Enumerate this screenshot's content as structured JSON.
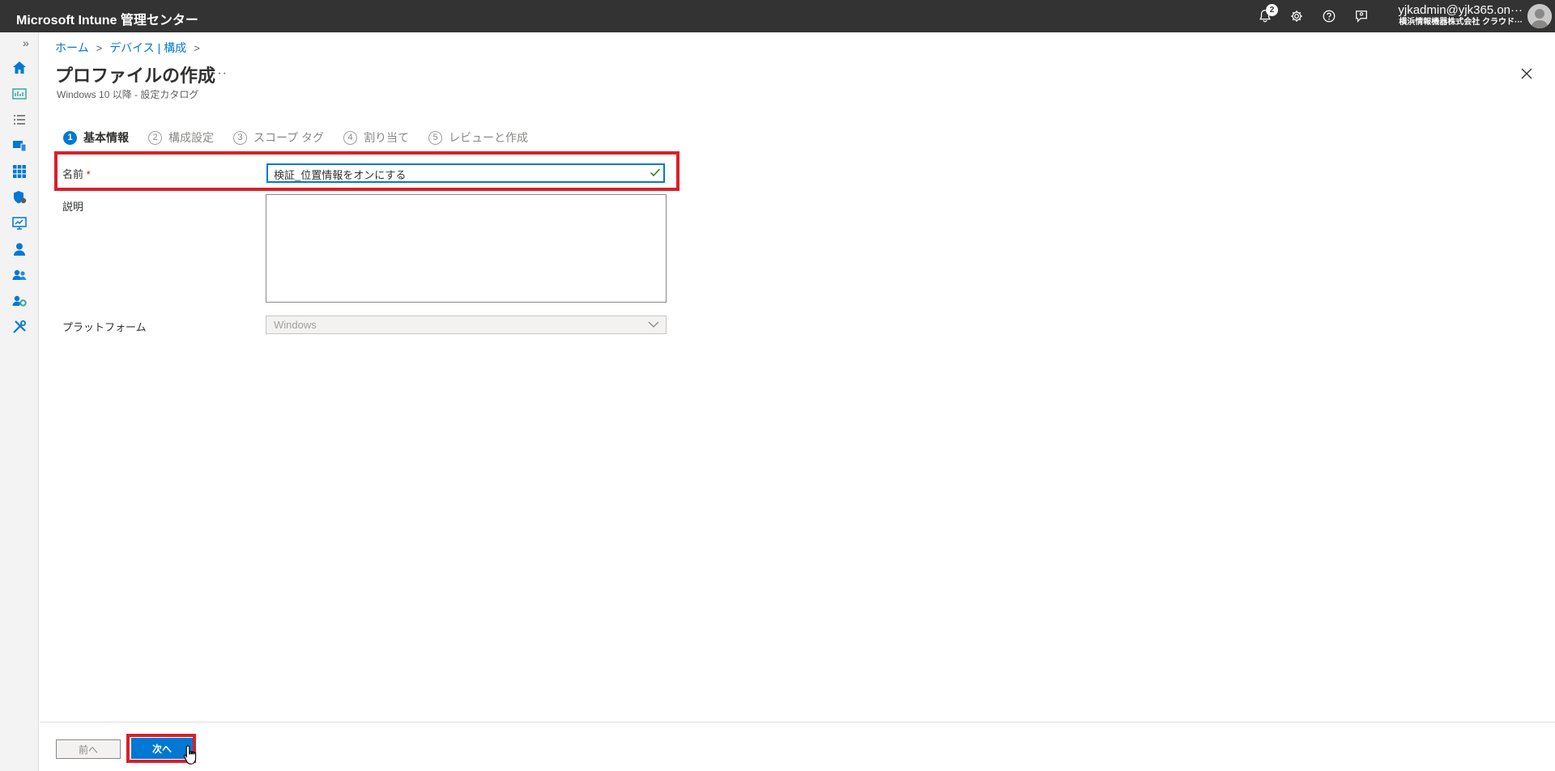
{
  "topbar": {
    "title": "Microsoft Intune 管理センター",
    "notification_count": "2",
    "icons": [
      "bell-icon",
      "gear-icon",
      "help-icon",
      "feedback-icon"
    ],
    "account_email": "yjkadmin@yjk365.on···",
    "account_org": "横浜情報機器株式会社 クラウド···"
  },
  "rail": {
    "expand_label": "»",
    "items": [
      "home-icon",
      "dashboard-icon",
      "all-services-icon",
      "devices-icon",
      "apps-icon",
      "endpoint-security-icon",
      "reports-icon",
      "users-icon",
      "groups-icon",
      "tenant-admin-icon",
      "troubleshooting-icon"
    ]
  },
  "breadcrumb": [
    "ホーム",
    "デバイス | 構成"
  ],
  "page": {
    "title": "プロファイルの作成",
    "more": "···",
    "subtitle": "Windows 10 以降 - 設定カタログ"
  },
  "steps": [
    {
      "num": "1",
      "label": "基本情報"
    },
    {
      "num": "2",
      "label": "構成設定"
    },
    {
      "num": "3",
      "label": "スコープ タグ"
    },
    {
      "num": "4",
      "label": "割り当て"
    },
    {
      "num": "5",
      "label": "レビューと作成"
    }
  ],
  "form": {
    "name_label": "名前",
    "required_mark": "*",
    "name_value": "検証_位置情報をオンにする",
    "description_label": "説明",
    "description_value": "",
    "platform_label": "プラットフォーム",
    "platform_value": "Windows"
  },
  "footer": {
    "prev_label": "前へ",
    "next_label": "次へ"
  },
  "colors": {
    "topbar": "#333333",
    "accent": "#0078d4",
    "highlight": "#d9202a"
  }
}
